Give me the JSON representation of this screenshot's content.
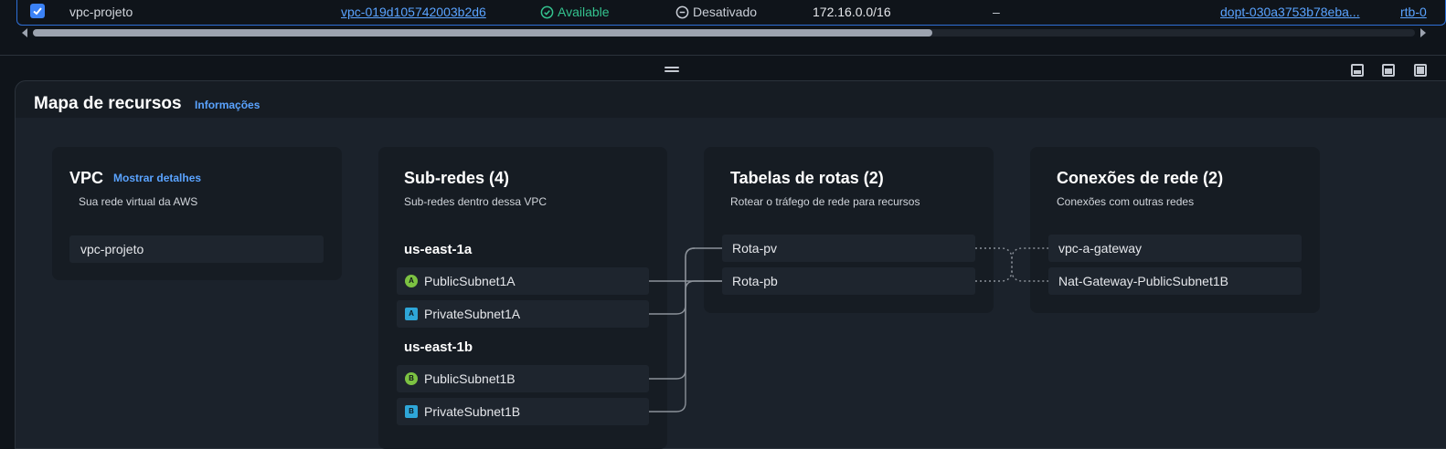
{
  "table_row": {
    "name": "vpc-projeto",
    "vpc_id": "vpc-019d105742003b2d6",
    "state": "Available",
    "block_public_access": "Desativado",
    "ipv4_cidr": "172.16.0.0/16",
    "ipv6_cidr": "–",
    "dhcp_options": "dopt-030a3753b78eba...",
    "route_table": "rtb-0"
  },
  "resource_map": {
    "title": "Mapa de recursos",
    "info_link": "Informações",
    "vpc_card": {
      "title": "VPC",
      "details_link": "Mostrar detalhes",
      "subtitle": "Sua rede virtual da AWS",
      "items": [
        "vpc-projeto"
      ]
    },
    "subnets_card": {
      "title": "Sub-redes (4)",
      "subtitle": "Sub-redes dentro dessa VPC",
      "groups": [
        {
          "zone": "us-east-1a",
          "subnets": [
            {
              "badge": "A",
              "kind": "public",
              "label": "PublicSubnet1A"
            },
            {
              "badge": "A",
              "kind": "private",
              "label": "PrivateSubnet1A"
            }
          ]
        },
        {
          "zone": "us-east-1b",
          "subnets": [
            {
              "badge": "B",
              "kind": "public",
              "label": "PublicSubnet1B"
            },
            {
              "badge": "B",
              "kind": "private",
              "label": "PrivateSubnet1B"
            }
          ]
        }
      ]
    },
    "route_tables_card": {
      "title": "Tabelas de rotas (2)",
      "subtitle": "Rotear o tráfego de rede para recursos",
      "items": [
        "Rota-pv",
        "Rota-pb"
      ]
    },
    "network_connections_card": {
      "title": "Conexões de rede (2)",
      "subtitle": "Conexões com outras redes",
      "items": [
        "vpc-a-gateway",
        "Nat-Gateway-PublicSubnet1B"
      ]
    }
  },
  "colors": {
    "accent_link": "#5aa3ff",
    "available": "#34c38f",
    "public_badge": "#7cc242",
    "private_badge": "#2ea6d8",
    "selection_border": "#2e6fd6"
  }
}
